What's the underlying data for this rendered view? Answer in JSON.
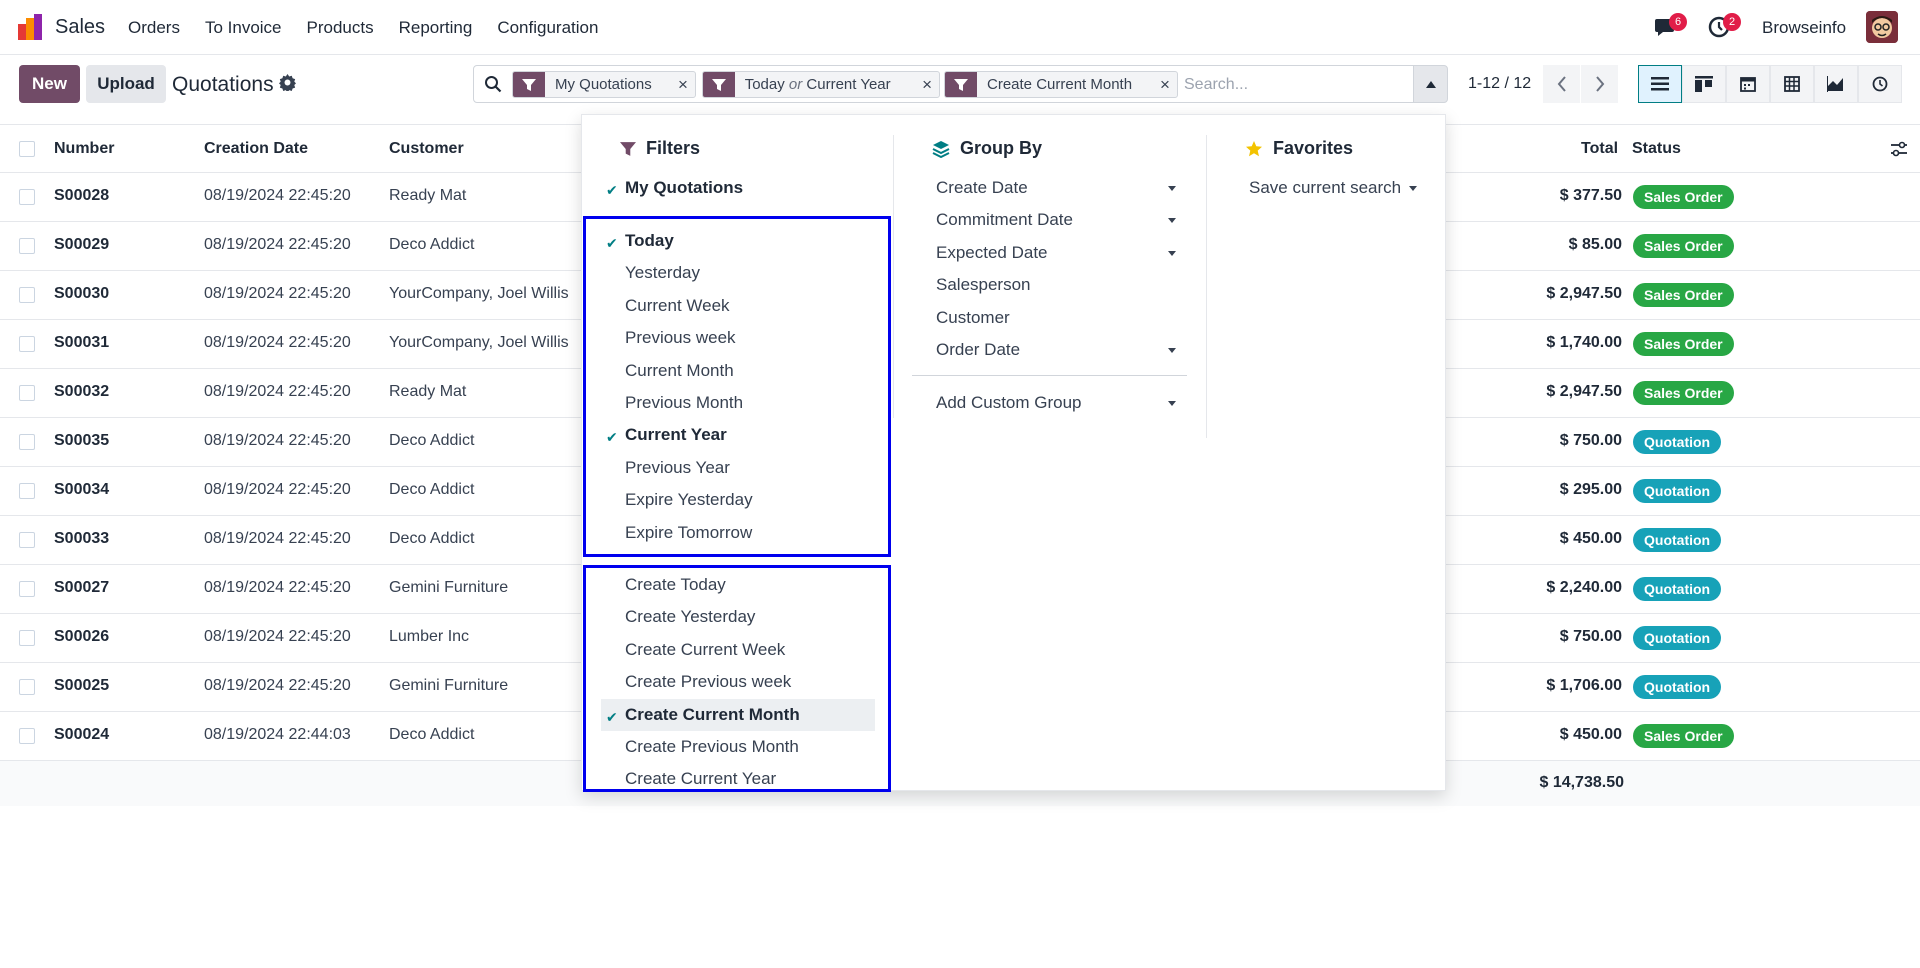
{
  "app": {
    "name": "Sales"
  },
  "menu": [
    "Orders",
    "To Invoice",
    "Products",
    "Reporting",
    "Configuration"
  ],
  "systray": {
    "chat_count": "6",
    "activity_count": "2",
    "user": "Browseinfo"
  },
  "toolbar": {
    "new_label": "New",
    "upload_label": "Upload",
    "title": "Quotations"
  },
  "search": {
    "facets": [
      {
        "label": "My Quotations"
      },
      {
        "label_a": "Today",
        "or": "or",
        "label_b": "Current Year"
      },
      {
        "label": "Create Current Month"
      }
    ],
    "close_glyph": "×",
    "placeholder": "Search..."
  },
  "pager": {
    "text": "1-12 / 12"
  },
  "colors": {
    "brand": "#714B67",
    "accent": "#017e84",
    "sales_order": "#28a745",
    "quotation": "#17a2b8"
  },
  "list": {
    "headers": {
      "number": "Number",
      "creation_date": "Creation Date",
      "customer": "Customer",
      "total": "Total",
      "status": "Status"
    },
    "rows": [
      {
        "number": "S00028",
        "date": "08/19/2024 22:45:20",
        "customer": "Ready Mat",
        "total": "$ 377.50",
        "status": "Sales Order"
      },
      {
        "number": "S00029",
        "date": "08/19/2024 22:45:20",
        "customer": "Deco Addict",
        "total": "$ 85.00",
        "status": "Sales Order"
      },
      {
        "number": "S00030",
        "date": "08/19/2024 22:45:20",
        "customer": "YourCompany, Joel Willis",
        "total": "$ 2,947.50",
        "status": "Sales Order"
      },
      {
        "number": "S00031",
        "date": "08/19/2024 22:45:20",
        "customer": "YourCompany, Joel Willis",
        "total": "$ 1,740.00",
        "status": "Sales Order"
      },
      {
        "number": "S00032",
        "date": "08/19/2024 22:45:20",
        "customer": "Ready Mat",
        "total": "$ 2,947.50",
        "status": "Sales Order"
      },
      {
        "number": "S00035",
        "date": "08/19/2024 22:45:20",
        "customer": "Deco Addict",
        "total": "$ 750.00",
        "status": "Quotation"
      },
      {
        "number": "S00034",
        "date": "08/19/2024 22:45:20",
        "customer": "Deco Addict",
        "total": "$ 295.00",
        "status": "Quotation"
      },
      {
        "number": "S00033",
        "date": "08/19/2024 22:45:20",
        "customer": "Deco Addict",
        "total": "$ 450.00",
        "status": "Quotation"
      },
      {
        "number": "S00027",
        "date": "08/19/2024 22:45:20",
        "customer": "Gemini Furniture",
        "total": "$ 2,240.00",
        "status": "Quotation"
      },
      {
        "number": "S00026",
        "date": "08/19/2024 22:45:20",
        "customer": "Lumber Inc",
        "total": "$ 750.00",
        "status": "Quotation"
      },
      {
        "number": "S00025",
        "date": "08/19/2024 22:45:20",
        "customer": "Gemini Furniture",
        "total": "$ 1,706.00",
        "status": "Quotation"
      },
      {
        "number": "S00024",
        "date": "08/19/2024 22:44:03",
        "customer": "Deco Addict",
        "total": "$ 450.00",
        "status": "Sales Order"
      }
    ],
    "grand_total": "$ 14,738.50"
  },
  "dropdown": {
    "filters": {
      "title": "Filters",
      "my_quotations": "My Quotations",
      "date_filters": [
        "Today",
        "Yesterday",
        "Current Week",
        "Previous week",
        "Current Month",
        "Previous Month",
        "Current Year",
        "Previous Year",
        "Expire Yesterday",
        "Expire Tomorrow"
      ],
      "create_filters": [
        "Create Today",
        "Create Yesterday",
        "Create Current Week",
        "Create Previous week",
        "Create Current Month",
        "Create Previous Month",
        "Create Current Year"
      ],
      "checked": [
        "My Quotations",
        "Today",
        "Current Year",
        "Create Current Month"
      ]
    },
    "group_by": {
      "title": "Group By",
      "items": [
        "Create Date",
        "Commitment Date",
        "Expected Date",
        "Salesperson",
        "Customer",
        "Order Date"
      ],
      "custom": "Add Custom Group"
    },
    "favorites": {
      "title": "Favorites",
      "save": "Save current search"
    }
  }
}
